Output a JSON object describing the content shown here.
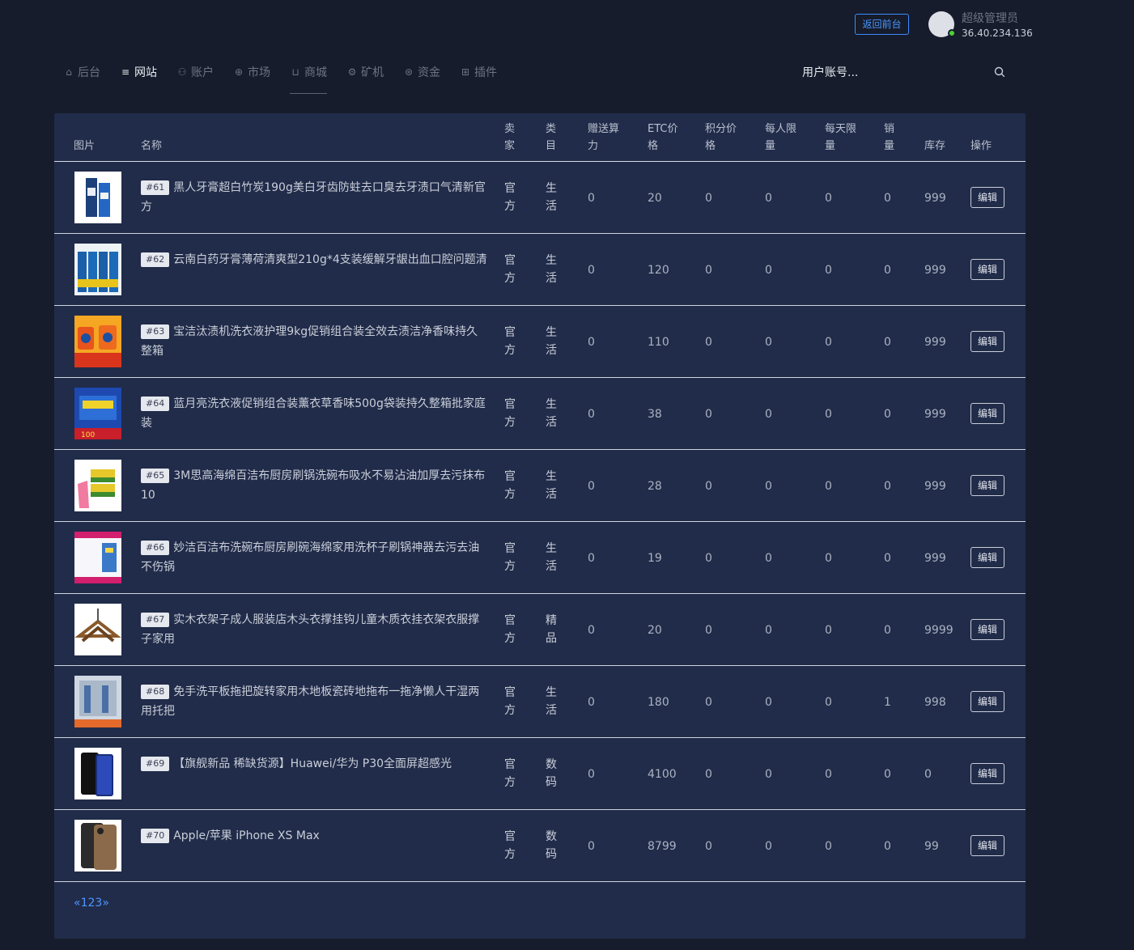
{
  "topbar": {
    "front_button": "返回前台",
    "user_name": "超级管理员",
    "user_ip": "36.40.234.136"
  },
  "nav": [
    {
      "icon": "home-icon",
      "glyph": "⌂",
      "label": "后台"
    },
    {
      "icon": "list-icon",
      "glyph": "≡",
      "label": "网站"
    },
    {
      "icon": "users-icon",
      "glyph": "⚇",
      "label": "账户"
    },
    {
      "icon": "globe-icon",
      "glyph": "⊕",
      "label": "市场"
    },
    {
      "icon": "cart-icon",
      "glyph": "⊔",
      "label": "商城"
    },
    {
      "icon": "miner-icon",
      "glyph": "⚙",
      "label": "矿机"
    },
    {
      "icon": "money-icon",
      "glyph": "⊛",
      "label": "资金"
    },
    {
      "icon": "grid-icon",
      "glyph": "⊞",
      "label": "插件"
    }
  ],
  "search": {
    "placeholder": "用户账号..."
  },
  "table": {
    "headers": {
      "image": "图片",
      "name": "名称",
      "seller": [
        "卖",
        "家"
      ],
      "category": [
        "类",
        "目"
      ],
      "gift_power": [
        "赠送算",
        "力"
      ],
      "etc_price": [
        "ETC价",
        "格"
      ],
      "points_price": [
        "积分价",
        "格"
      ],
      "per_person_limit": [
        "每人限",
        "量"
      ],
      "per_day_limit": [
        "每天限",
        "量"
      ],
      "sales": [
        "销",
        "量"
      ],
      "stock": "库存",
      "actions": "操作"
    },
    "edit_label": "编辑",
    "rows": [
      {
        "id": "#61",
        "name": "黑人牙膏超白竹炭190g美白牙齿防蛀去口臭去牙渍口气清新官方",
        "seller": [
          "官",
          "方"
        ],
        "category": [
          "生",
          "活"
        ],
        "gift": "0",
        "etc": "20",
        "points": "0",
        "per_person": "0",
        "per_day": "0",
        "sales": "0",
        "stock": "999",
        "thumb": "toothpaste-dark"
      },
      {
        "id": "#62",
        "name": "云南白药牙膏薄荷清爽型210g*4支装缓解牙龈出血口腔问题清",
        "seller": [
          "官",
          "方"
        ],
        "category": [
          "生",
          "活"
        ],
        "gift": "0",
        "etc": "120",
        "points": "0",
        "per_person": "0",
        "per_day": "0",
        "sales": "0",
        "stock": "999",
        "thumb": "toothpaste-set"
      },
      {
        "id": "#63",
        "name": "宝洁汰渍机洗衣液护理9kg促销组合装全效去渍洁净香味持久整箱",
        "seller": [
          "官",
          "方"
        ],
        "category": [
          "生",
          "活"
        ],
        "gift": "0",
        "etc": "110",
        "points": "0",
        "per_person": "0",
        "per_day": "0",
        "sales": "0",
        "stock": "999",
        "thumb": "detergent-orange"
      },
      {
        "id": "#64",
        "name": "蓝月亮洗衣液促销组合装薰衣草香味500g袋装持久整箱批家庭装",
        "seller": [
          "官",
          "方"
        ],
        "category": [
          "生",
          "活"
        ],
        "gift": "0",
        "etc": "38",
        "points": "0",
        "per_person": "0",
        "per_day": "0",
        "sales": "0",
        "stock": "999",
        "thumb": "detergent-blue"
      },
      {
        "id": "#65",
        "name": "3M思高海绵百洁布厨房刷锅洗碗布吸水不易沾油加厚去污抹布10",
        "seller": [
          "官",
          "方"
        ],
        "category": [
          "生",
          "活"
        ],
        "gift": "0",
        "etc": "28",
        "points": "0",
        "per_person": "0",
        "per_day": "0",
        "sales": "0",
        "stock": "999",
        "thumb": "sponge"
      },
      {
        "id": "#66",
        "name": "妙洁百洁布洗碗布厨房刷碗海绵家用洗杯子刷锅神器去污去油不伤锅",
        "seller": [
          "官",
          "方"
        ],
        "category": [
          "生",
          "活"
        ],
        "gift": "0",
        "etc": "19",
        "points": "0",
        "per_person": "0",
        "per_day": "0",
        "sales": "0",
        "stock": "999",
        "thumb": "dish-cloth"
      },
      {
        "id": "#67",
        "name": "实木衣架子成人服装店木头衣撑挂钩儿童木质衣挂衣架衣服撑子家用",
        "seller": [
          "官",
          "方"
        ],
        "category": [
          "精",
          "品"
        ],
        "gift": "0",
        "etc": "20",
        "points": "0",
        "per_person": "0",
        "per_day": "0",
        "sales": "0",
        "stock": "9999",
        "thumb": "hanger"
      },
      {
        "id": "#68",
        "name": "免手洗平板拖把旋转家用木地板瓷砖地拖布一拖净懒人干湿两用托把",
        "seller": [
          "官",
          "方"
        ],
        "category": [
          "生",
          "活"
        ],
        "gift": "0",
        "etc": "180",
        "points": "0",
        "per_person": "0",
        "per_day": "0",
        "sales": "1",
        "stock": "998",
        "thumb": "mop"
      },
      {
        "id": "#69",
        "name": "【旗舰新品 稀缺货源】Huawei/华为 P30全面屏超感光",
        "seller": [
          "官",
          "方"
        ],
        "category": [
          "数",
          "码"
        ],
        "gift": "0",
        "etc": "4100",
        "points": "0",
        "per_person": "0",
        "per_day": "0",
        "sales": "0",
        "stock": "0",
        "thumb": "phone-huawei"
      },
      {
        "id": "#70",
        "name": "Apple/苹果 iPhone XS Max",
        "seller": [
          "官",
          "方"
        ],
        "category": [
          "数",
          "码"
        ],
        "gift": "0",
        "etc": "8799",
        "points": "0",
        "per_person": "0",
        "per_day": "0",
        "sales": "0",
        "stock": "99",
        "thumb": "phone-iphone"
      }
    ]
  },
  "pagination": {
    "prev": "«",
    "pages": [
      "1",
      "2",
      "3"
    ],
    "next": "»"
  }
}
